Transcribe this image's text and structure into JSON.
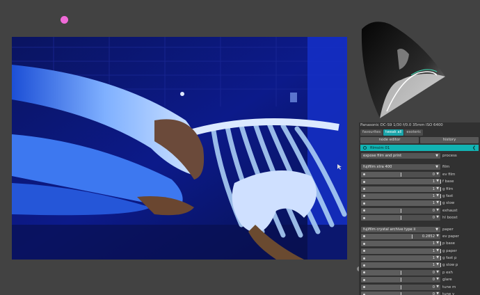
{
  "camera_info": "Panasonic DC-S9 1/30 f/0.0 35mm ISO 6400",
  "tabs": [
    "favourites",
    "tweak all",
    "esoteric"
  ],
  "active_tab": "tweak all",
  "buttons": {
    "node_editor": "node editor",
    "history": "history"
  },
  "module": {
    "name": "filmsim 01",
    "collapse_icon": "chevron-left-icon"
  },
  "controls": {
    "process": {
      "value": "expose film and print",
      "label": "process"
    },
    "film": {
      "value": "fujifilm xtra 400",
      "label": "film"
    },
    "film_sliders": [
      {
        "label": "ev film",
        "value": "0"
      },
      {
        "label": "f base",
        "value": "1"
      },
      {
        "label": "g film",
        "value": "1"
      },
      {
        "label": "g fast",
        "value": "1"
      },
      {
        "label": "g slow",
        "value": "1"
      },
      {
        "label": "exhaust",
        "value": "0"
      },
      {
        "label": "hl boost",
        "value": "0"
      }
    ],
    "paper": {
      "value": "fujifilm crystal archive type ii",
      "label": "paper"
    },
    "paper_sliders": [
      {
        "label": "ev paper",
        "value": "0.2852"
      },
      {
        "label": "p base",
        "value": "1"
      },
      {
        "label": "g paper",
        "value": "1"
      },
      {
        "label": "g fast p",
        "value": "1"
      },
      {
        "label": "g slow p",
        "value": "1"
      },
      {
        "label": "p exh",
        "value": "0"
      },
      {
        "label": "glare",
        "value": "0"
      },
      {
        "label": "tune m",
        "value": "0"
      },
      {
        "label": "tune y",
        "value": "0"
      }
    ]
  },
  "colors": {
    "accent": "#12b3b3",
    "marker": "#f06ad8",
    "background": "#424242"
  }
}
